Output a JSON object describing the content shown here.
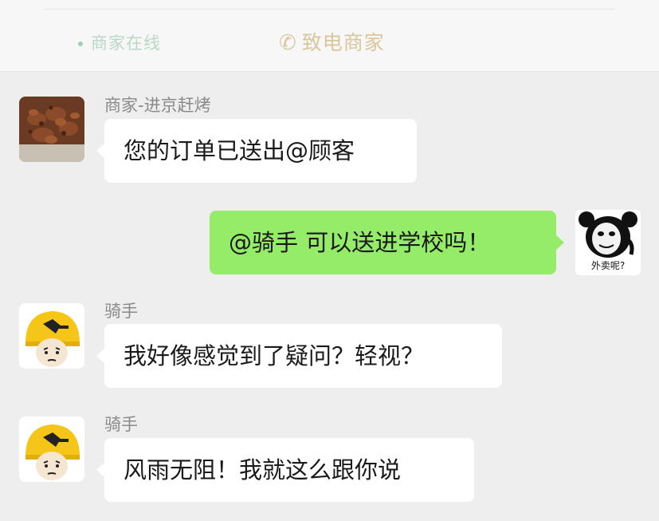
{
  "header": {
    "status": "商家在线",
    "call_label": "致电商家",
    "call_icon": "phone-icon"
  },
  "messages": [
    {
      "side": "left",
      "sender": "商家-进京赶烤",
      "text": "您的订单已送出@顾客",
      "avatar": "bbq-avatar"
    },
    {
      "side": "right",
      "text": "@骑手 可以送进学校吗！",
      "avatar": "panda-meme-avatar",
      "avatar_caption": "外卖呢?"
    },
    {
      "side": "left",
      "sender": "骑手",
      "text": "我好像感觉到了疑问？轻视？",
      "avatar": "rider-helmet-avatar"
    },
    {
      "side": "left",
      "sender": "骑手",
      "text": "风雨无阻！我就这么跟你说",
      "avatar": "rider-helmet-avatar"
    }
  ],
  "colors": {
    "background": "#eeeeee",
    "bubble_left": "#ffffff",
    "bubble_right": "#95ec69",
    "helmet": "#f5c518"
  }
}
